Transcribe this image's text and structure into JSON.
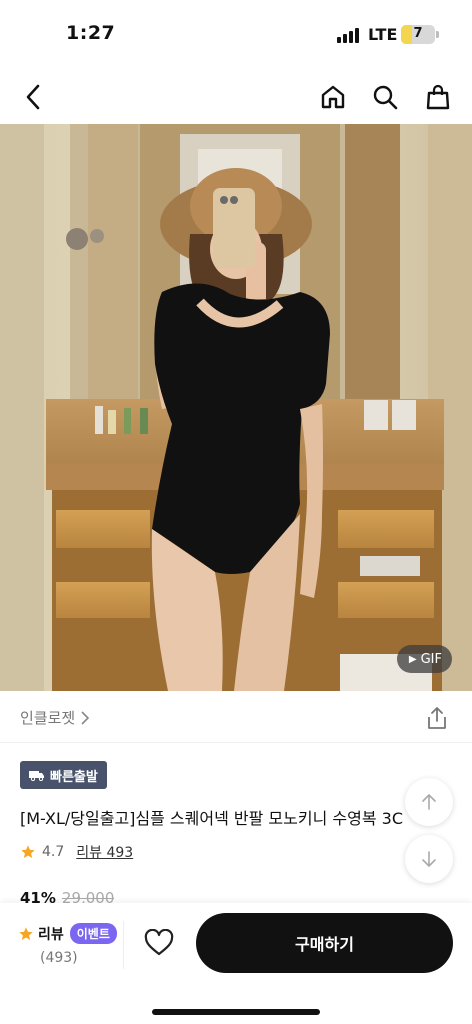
{
  "status_bar": {
    "time": "1:27",
    "network": "LTE",
    "battery": "7"
  },
  "nav": {
    "back_icon": "chevron-left-icon",
    "home_icon": "home-icon",
    "search_icon": "search-icon",
    "cart_icon": "shopping-bag-icon"
  },
  "product_image": {
    "gif_label": "GIF"
  },
  "brand": {
    "name": "인클로젯"
  },
  "product": {
    "badge": "빠른출발",
    "title": "[M-XL/당일출고]심플 스퀘어넥 반팔 모노키니 수영복 3C",
    "rating": "4.7",
    "review_link": "리뷰 493",
    "discount": "41%",
    "original_price": "29,000"
  },
  "bottom_bar": {
    "review_label": "리뷰",
    "event_badge": "이벤트",
    "review_count": "(493)",
    "buy_label": "구매하기"
  },
  "colors": {
    "accent_purple": "#7a66f0",
    "badge_navy": "#48536b",
    "star_orange": "#f5a623",
    "buy_black": "#111111"
  }
}
